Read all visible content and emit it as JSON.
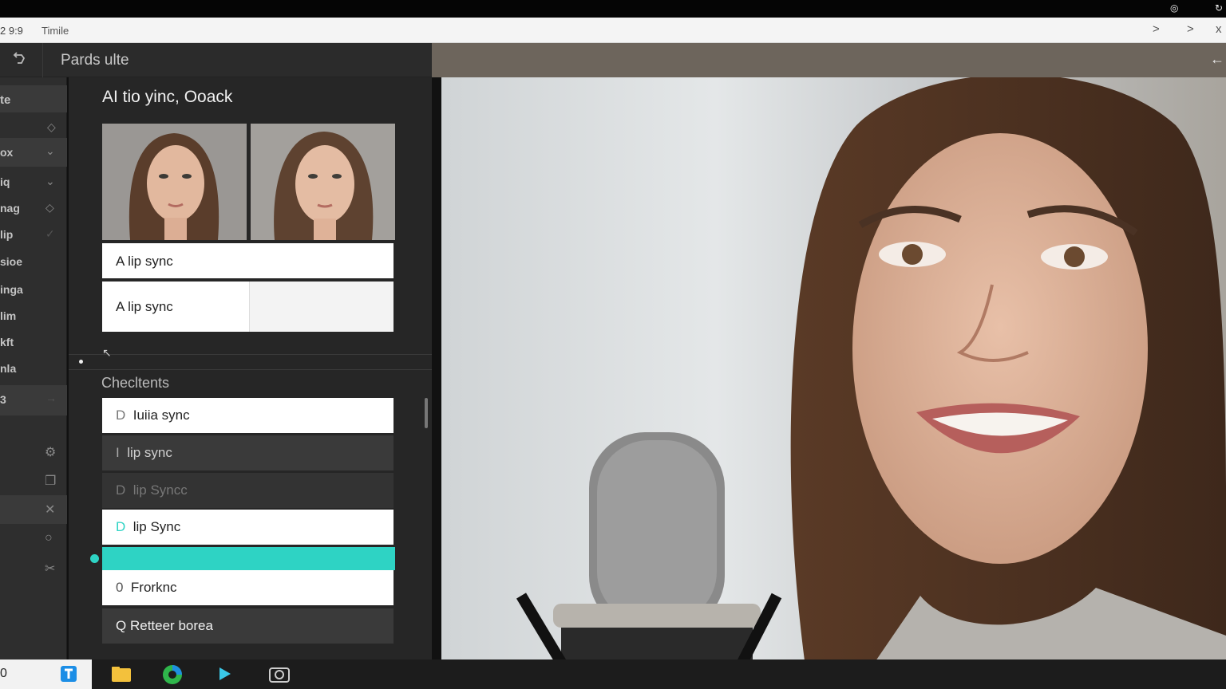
{
  "system": {
    "icons": [
      "settings-icon",
      "power-icon"
    ]
  },
  "titlebar": {
    "time": "2 9:9",
    "name": "Timile",
    "nav": [
      ">",
      ">",
      "x"
    ]
  },
  "app": {
    "title": "Pards ulte"
  },
  "sidebar": {
    "items": [
      {
        "label": "te",
        "icon": ""
      },
      {
        "label": "",
        "icon": "pin-icon"
      },
      {
        "label": "ox",
        "icon": "chevron-down-icon"
      },
      {
        "label": "iq",
        "icon": "chevron-down-icon"
      },
      {
        "label": "nag",
        "icon": "pin-icon"
      },
      {
        "label": "lip",
        "icon": "check-icon"
      },
      {
        "label": "sioe",
        "icon": ""
      },
      {
        "label": "inga",
        "icon": ""
      },
      {
        "label": "lim",
        "icon": ""
      },
      {
        "label": "kft",
        "icon": ""
      },
      {
        "label": "nla",
        "icon": ""
      },
      {
        "label": "3",
        "icon": "arrow-icon"
      }
    ]
  },
  "panel": {
    "title": "AI tio yinc, Ooack",
    "fields": [
      "A lip sync",
      "A lip sync"
    ],
    "section_label": "Checltents",
    "rows": [
      {
        "mark": "D",
        "text": "Iuiia sync"
      },
      {
        "mark": "I",
        "text": "lip sync"
      },
      {
        "mark": "D",
        "text": "lip Syncc"
      },
      {
        "mark": "D",
        "text": "lip Sync"
      },
      {
        "mark": "0",
        "text": "Frorknc"
      },
      {
        "mark": "Q",
        "text": "Retteer borea"
      }
    ]
  },
  "taskbar": {
    "left_text": "0"
  },
  "colors": {
    "accent": "#2ed3c4",
    "panel": "#262626",
    "sidebar": "#2e2e2e"
  }
}
